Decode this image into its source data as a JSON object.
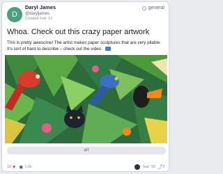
{
  "post": {
    "tag": "general",
    "avatar_letter": "D",
    "author_name": "Daryl James",
    "author_handle": "@daryljames",
    "created": "Created Feb '13",
    "title": "Whoa. Check out this crazy paper artwork",
    "body_line1": "This is pretty awesome! The artist makes paper sculptures that are very pliable.",
    "body_line2": "It's sort of hard to describe – check out the video.",
    "caption": "art",
    "likes": "18",
    "views": "1.6k",
    "date": "Sep '15",
    "replies": "3"
  },
  "colors": {
    "avatar": "#4aa27c",
    "accent": "#3b83d6",
    "heart": "#e0245e"
  },
  "icons": {
    "tag": "circle-icon",
    "video": "video-icon",
    "like": "heart-icon",
    "views": "eye-icon",
    "share": "share-icon"
  }
}
